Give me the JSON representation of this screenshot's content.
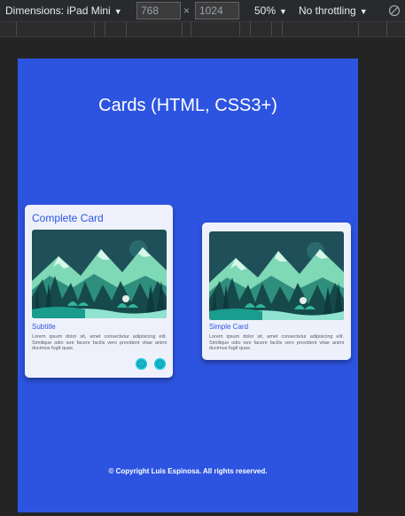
{
  "devtools": {
    "dimensions_label": "Dimensions: iPad Mini",
    "width_value": "768",
    "times": "×",
    "height_value": "1024",
    "zoom": "50%",
    "throttling": "No throttling",
    "dropdown_icon": "caret-down-icon",
    "rotate_icon": "rotate-icon"
  },
  "page": {
    "title": "Cards (HTML, CSS3+)",
    "footer": "© Copyright Luis Espinosa. All rights reserved.",
    "background": "#2d54e0"
  },
  "cards": {
    "complete": {
      "title": "Complete Card",
      "subtitle": "Subtitle",
      "text": "Lorem ipsum dolor sit, amet consectetur adipisicing elit. Similique odio iure facere facilis vero provident vitae animi ducimus fugit quas.",
      "happy_icon": "smile-icon",
      "sad_icon": "frown-icon"
    },
    "simple": {
      "subtitle": "Simple Card",
      "text": "Lorem ipsum dolor sit, amet consectetur adipisicing elit. Similique odio iure facere facilis vero provident vitae animi ducimus fugit quas."
    }
  }
}
